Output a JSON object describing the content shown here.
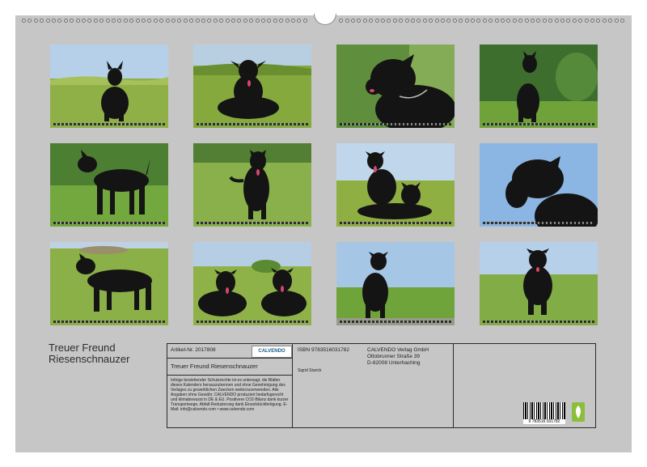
{
  "calendar": {
    "title_line1": "Treuer Freund",
    "title_line2": "Riesenschnauzer",
    "photos": [
      {
        "id": "photo-jan",
        "subject": "schnauzer-standing-meadow"
      },
      {
        "id": "photo-feb",
        "subject": "schnauzer-lying-meadow"
      },
      {
        "id": "photo-mar",
        "subject": "schnauzer-portrait-collar"
      },
      {
        "id": "photo-apr",
        "subject": "schnauzer-sitting-garden"
      },
      {
        "id": "photo-may",
        "subject": "schnauzer-walking-lawn"
      },
      {
        "id": "photo-jun",
        "subject": "schnauzer-standing-grass"
      },
      {
        "id": "photo-jul",
        "subject": "two-schnauzers-field"
      },
      {
        "id": "photo-aug",
        "subject": "schnauzer-profile-sky"
      },
      {
        "id": "photo-sep",
        "subject": "schnauzer-trotting-field"
      },
      {
        "id": "photo-oct",
        "subject": "two-schnauzers-lying"
      },
      {
        "id": "photo-nov",
        "subject": "schnauzer-sitting-path"
      },
      {
        "id": "photo-dec",
        "subject": "schnauzer-standing-field"
      }
    ]
  },
  "imprint": {
    "article_no": "Artikel-Nr. 2017808",
    "logo_text": "CALVENDO",
    "product_title": "Treuer Freund Riesenschnauzer",
    "legal_text": "Infolge bestehender Schutzrechte ist es untersagt, die Blätter dieses Kalenders herauszutrennen und ohne Genehmigung des Verlages zu gewerblichen Zwecken weiterzuverwenden. Alle Angaben ohne Gewähr. CALVENDO produziert bedarfsgerecht und klimabewusst in DE & EU. Positivere CO2-Bilanz dank kurzer Transportwege, Abfall-Reduzierung dank Einzelstückfertigung. E-Mail: info@calvendo.com • www.calvendo.com",
    "isbn": "ISBN 9783516031782",
    "author": "Sigrid Starick",
    "publisher_name": "CALVENDO Verlag GmbH",
    "publisher_street": "Ottobrunner Straße 39",
    "publisher_city": "D-82008 Unterhaching",
    "ean": "9 783516 031782"
  },
  "colors": {
    "page_bg": "#c6c6c6",
    "grass": "#7fae3c",
    "sky": "#a8c8e4",
    "dog": "#141414"
  }
}
